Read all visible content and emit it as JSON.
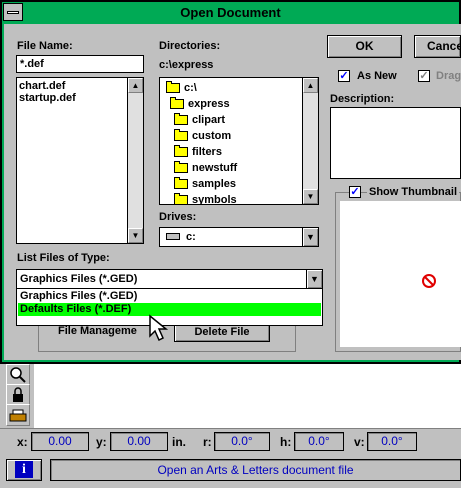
{
  "dialog": {
    "title": "Open Document",
    "file_name_label": "File Name:",
    "file_name_value": "*.def",
    "files": [
      "chart.def",
      "startup.def"
    ],
    "directories_label": "Directories:",
    "current_dir": "c:\\express",
    "dir_tree": [
      {
        "label": "c:\\",
        "kind": "open"
      },
      {
        "label": "express",
        "kind": "open"
      },
      {
        "label": "clipart",
        "kind": "closed"
      },
      {
        "label": "custom",
        "kind": "closed"
      },
      {
        "label": "filters",
        "kind": "closed"
      },
      {
        "label": "newstuff",
        "kind": "closed"
      },
      {
        "label": "samples",
        "kind": "closed"
      },
      {
        "label": "symbols",
        "kind": "closed"
      }
    ],
    "drives_label": "Drives:",
    "drive_value": "c:",
    "list_type_label": "List Files of Type:",
    "list_type_value": "Graphics Files (*.GED)",
    "type_options": [
      "Graphics Files (*.GED)",
      "Defaults Files (*.DEF)"
    ],
    "ok_label": "OK",
    "cancel_label": "Cance",
    "as_new_label": "As New",
    "drag_label": "Drag",
    "description_label": "Description:",
    "show_thumbnail_label": "Show Thumbnail",
    "file_management_label": "File Manageme",
    "delete_file_label": "Delete File"
  },
  "status": {
    "x_label": "x:",
    "x_value": "0.00",
    "y_label": "y:",
    "y_value": "0.00",
    "unit": "in.",
    "r_label": "r:",
    "r_value": "0.0°",
    "h_label": "h:",
    "h_value": "0.0°",
    "v_label": "v:",
    "v_value": "0.0°",
    "info_icon": "i",
    "message": "Open an Arts & Letters document file"
  },
  "colors": {
    "title_bar": "#00aa55",
    "selection": "#00ff00",
    "status_text": "#0000c0"
  }
}
